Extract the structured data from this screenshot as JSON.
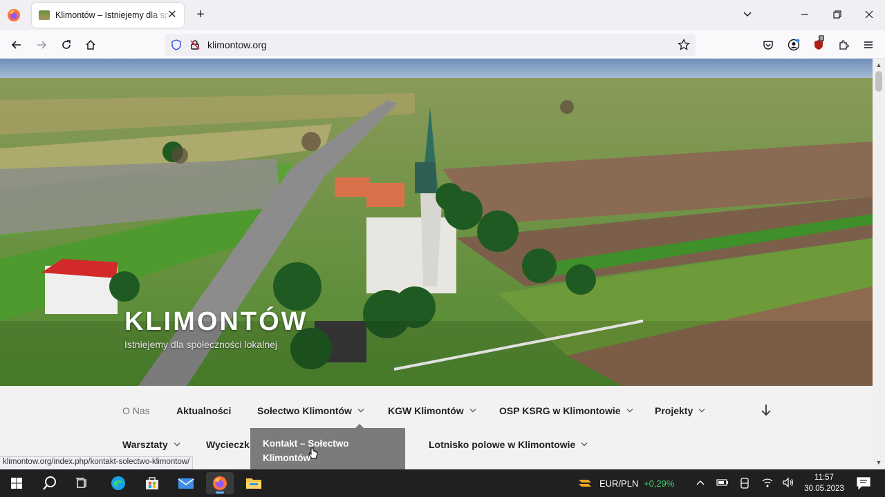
{
  "browser": {
    "tab_title": "Klimontów – Istniejemy dla społeczności lokalnej",
    "url": "klimontow.org",
    "extension_badge": "6",
    "status_url": "klimontow.org/index.php/kontakt-solectwo-klimontow/"
  },
  "hero": {
    "title": "KLIMONTÓW",
    "subtitle": "Istniejemy dla społeczności lokalnej"
  },
  "menu": {
    "row1": [
      {
        "label": "O Nas"
      },
      {
        "label": "Aktualności"
      },
      {
        "label": "Sołectwo Klimontów"
      },
      {
        "label": "KGW Klimontów"
      },
      {
        "label": "OSP KSRG w Klimontowie"
      },
      {
        "label": "Projekty"
      }
    ],
    "row2": [
      {
        "label": "Warsztaty"
      },
      {
        "label": "Wycieczk"
      },
      {
        "label": "Lotnisko polowe w Klimontowie"
      }
    ],
    "dropdown_item": "Kontakt – Sołectwo Klimontów"
  },
  "taskbar": {
    "currency_pair": "EUR/PLN",
    "currency_change": "+0,29%",
    "time": "11:57",
    "date": "30.05.2023"
  },
  "colors": {
    "accent_green": "#3cd070",
    "dropdown_bg": "#7b7b7b",
    "taskbar_bg": "#202020"
  }
}
